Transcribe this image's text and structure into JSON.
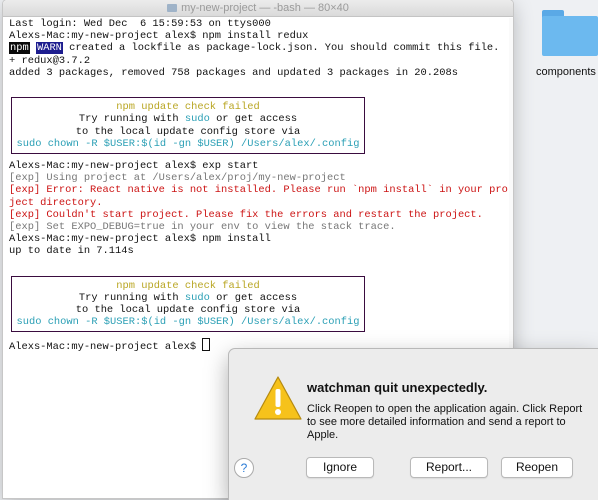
{
  "desktop": {
    "folder_label": "components"
  },
  "terminal": {
    "title": "my-new-project — -bash — 80×40",
    "lines": [
      "Last login: Wed Dec  6 15:59:53 on ttys000",
      "Alexs-Mac:my-new-project alex$ npm install redux",
      "npm WARN created a lockfile as package-lock.json. You should commit this file.",
      "+ redux@3.7.2",
      "added 3 packages, removed 758 packages and updated 3 packages in 20.208s"
    ],
    "box1": {
      "header": "npm update check failed",
      "line2a": "Try running with ",
      "line2b": "sudo",
      "line2c": " or get access",
      "line3": "to the local update config store via",
      "line4": "sudo chown -R $USER:$(id -gn $USER) /Users/alex/.config"
    },
    "lines2": [
      "Alexs-Mac:my-new-project alex$ exp start",
      "[exp] Using project at /Users/alex/proj/my-new-project",
      "[exp] Error: React native is not installed. Please run `npm install` in your pro",
      "ject directory.",
      "[exp] Couldn't start project. Please fix the errors and restart the project.",
      "[exp] Set EXPO_DEBUG=true in your env to view the stack trace.",
      "Alexs-Mac:my-new-project alex$ npm install",
      "up to date in 7.114s"
    ],
    "box2": {
      "header": "npm update check failed",
      "line2a": "Try running with ",
      "line2b": "sudo",
      "line2c": " or get access",
      "line3": "to the local update config store via",
      "line4": "sudo chown -R $USER:$(id -gn $USER) /Users/alex/.config"
    },
    "prompt": "Alexs-Mac:my-new-project alex$ "
  },
  "dialog": {
    "title": "watchman quit unexpectedly.",
    "message": "Click Reopen to open the application again. Click Report to see more detailed information and send a report to Apple.",
    "help": "?",
    "ignore": "Ignore",
    "report": "Report...",
    "reopen": "Reopen"
  },
  "colors": {
    "warning_yellow": "#f6c21b",
    "error_red": "#cc1414",
    "cyan": "#2a9fb5"
  },
  "icons": [
    "folder-icon",
    "warning-icon",
    "help-icon"
  ]
}
